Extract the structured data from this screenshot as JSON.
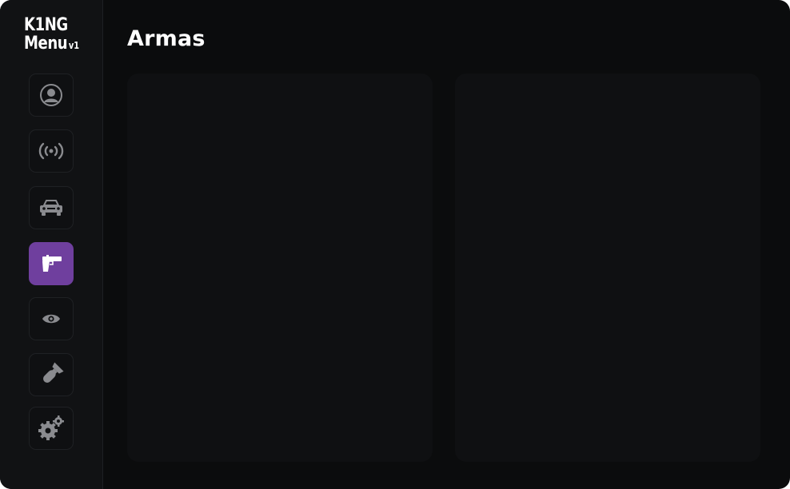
{
  "app": {
    "logo_line1": "K1NG",
    "logo_line2": "Menu",
    "logo_version": "v1"
  },
  "sidebar": {
    "items": [
      {
        "icon": "user-icon",
        "active": false
      },
      {
        "icon": "broadcast-icon",
        "active": false
      },
      {
        "icon": "car-icon",
        "active": false
      },
      {
        "icon": "pistol-icon",
        "active": true
      },
      {
        "icon": "eye-icon",
        "active": false
      },
      {
        "icon": "bomb-icon",
        "active": false
      },
      {
        "icon": "gears-icon",
        "active": false
      }
    ]
  },
  "page": {
    "title": "Armas"
  },
  "colors": {
    "background": "#0b0c0d",
    "sidebar": "#111214",
    "panel": "#0f1012",
    "accent": "#6f3f9e",
    "icon": "#8a8b8f"
  }
}
